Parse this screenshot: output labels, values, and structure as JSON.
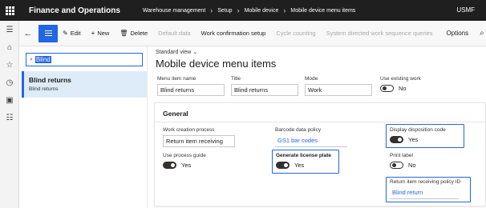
{
  "app": {
    "title": "Finance and Operations",
    "company": "USMF"
  },
  "breadcrumb": [
    "Warehouse management",
    "Setup",
    "Mobile device",
    "Mobile device menu items"
  ],
  "actions": {
    "edit": "Edit",
    "new": "New",
    "delete": "Delete",
    "default_data": "Default data",
    "work_confirmation_setup": "Work confirmation setup",
    "cycle_counting": "Cycle counting",
    "system_directed": "System directed work sequence queries",
    "options": "Options"
  },
  "list": {
    "filter_value": "Blind",
    "items": [
      {
        "title": "Blind returns",
        "subtitle": "Blind returns"
      }
    ]
  },
  "detail": {
    "view_selector": "Standard view",
    "page_title": "Mobile device menu items",
    "header_fields": {
      "menu_item_name": {
        "label": "Menu item name",
        "value": "Blind returns"
      },
      "title": {
        "label": "Title",
        "value": "Blind returns"
      },
      "mode": {
        "label": "Mode",
        "value": "Work"
      },
      "use_existing_work": {
        "label": "Use existing work",
        "value": "No",
        "on": false
      }
    },
    "general": {
      "title": "General",
      "work_creation_process": {
        "label": "Work creation process",
        "value": "Return item receiving"
      },
      "barcode_data_policy": {
        "label": "Barcode data policy",
        "value": "GS1 bar codes"
      },
      "display_disposition_code": {
        "label": "Display disposition code",
        "value": "Yes",
        "on": true
      },
      "use_process_guide": {
        "label": "Use process guide",
        "value": "Yes",
        "on": true
      },
      "generate_license_plate": {
        "label": "Generate license plate",
        "value": "Yes",
        "on": true
      },
      "print_label": {
        "label": "Print label",
        "value": "No",
        "on": false
      },
      "return_item_receiving_policy_id": {
        "label": "Return item receiving policy ID",
        "value": "Blind return"
      }
    }
  },
  "colors": {
    "topbar": "#1f1f1f",
    "accent": "#2266e3",
    "selected_row": "#deecf9"
  }
}
